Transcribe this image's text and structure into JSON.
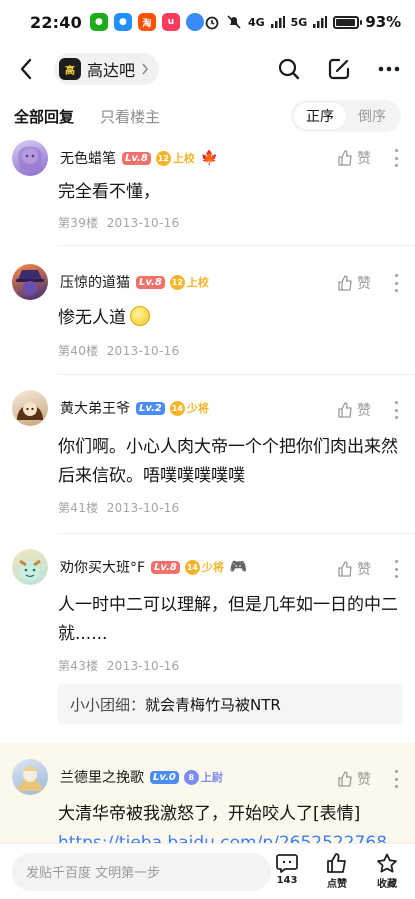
{
  "status_bar": {
    "time": "22:40",
    "apps": [
      {
        "name": "wechat-icon",
        "glyph": "●",
        "color": "#1aad19"
      },
      {
        "name": "qq-icon",
        "glyph": "●",
        "color": "#1e90ff"
      },
      {
        "name": "taobao-icon",
        "glyph": "淘",
        "color": "#ff5000"
      },
      {
        "name": "chinatelecom-icon",
        "glyph": "u",
        "color": "#ff3b5c"
      },
      {
        "name": "browser-icon",
        "glyph": "●",
        "color": "#3b8bf6"
      }
    ],
    "network": "4G",
    "network2": "5G",
    "battery": "93%",
    "battery_level": 0.93
  },
  "nav": {
    "forum_name": "高达吧",
    "forum_avatar_text": "高"
  },
  "tabs": {
    "all_replies": "全部回复",
    "op_only": "只看楼主",
    "sort_asc": "正序",
    "sort_desc": "倒序"
  },
  "posts": [
    {
      "username": "无色蜡笔",
      "level": "Lv.8",
      "level_color": "#f0726b",
      "title_num": "12",
      "title": "上校",
      "title_color": "#f5b52a",
      "extra": "🍁",
      "text": "完全看不懂，",
      "floor": "第39楼",
      "date": "2013-10-16",
      "like": "赞",
      "avatar_colors": [
        "#b9a3e6",
        "#7a5fb8"
      ]
    },
    {
      "username": "压惊的道猫",
      "level": "Lv.8",
      "level_color": "#f0726b",
      "title_num": "12",
      "title": "上校",
      "title_color": "#f5b52a",
      "text": "惨无人道",
      "floor": "第40楼",
      "date": "2013-10-16",
      "like": "赞",
      "avatar_colors": [
        "#e35f2a",
        "#4a3b8f"
      ]
    },
    {
      "username": "黄大弟王爷",
      "level": "Lv.2",
      "level_color": "#4a8df5",
      "title_num": "14",
      "title": "少将",
      "title_color": "#f5b52a",
      "text": "你们啊。小心人肉大帝一个个把你们肉出来然后来信砍。唔噗噗噗噗噗",
      "floor": "第41楼",
      "date": "2013-10-16",
      "like": "赞",
      "avatar_colors": [
        "#f2d8b8",
        "#6e4020"
      ]
    },
    {
      "username": "劝你买大班°F",
      "level": "Lv.8",
      "level_color": "#f0726b",
      "title_num": "14",
      "title": "少将",
      "title_color": "#f5b52a",
      "extra": "🎮",
      "text": "人一时中二可以理解，但是几年如一日的中二就......",
      "floor": "第43楼",
      "date": "2013-10-16",
      "like": "赞",
      "reply_name": "小小团细：",
      "reply_text": "就会青梅竹马被NTR",
      "avatar_colors": [
        "#e8d6a8",
        "#9bd3c8"
      ]
    },
    {
      "username": "兰德里之挽歌",
      "level": "Lv.0",
      "level_color": "#4a8df5",
      "title_num": "8",
      "title": "上尉",
      "title_color": "#7e8cf2",
      "text": "大清华帝被我激怒了，开始咬人了[表情]",
      "link": "https://tieba.baidu.com/p/2652522768",
      "like": "赞",
      "avatar_colors": [
        "#c9d8ee",
        "#d6b06a"
      ]
    }
  ],
  "bottom_bar": {
    "placeholder": "发贴千百度 文明第一步",
    "comment_count": "143",
    "like_label": "点赞",
    "fav_label": "收藏"
  }
}
